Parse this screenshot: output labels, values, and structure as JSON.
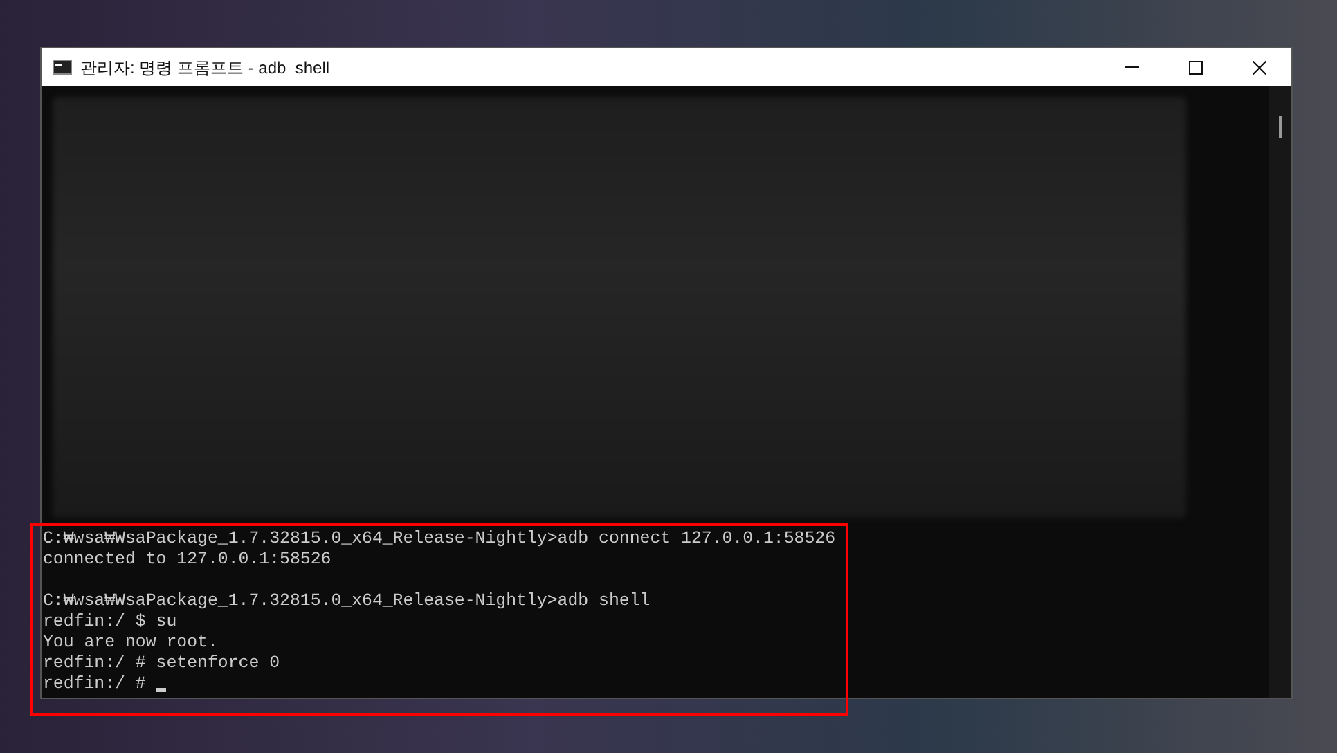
{
  "window": {
    "title": "관리자: 명령 프롬프트 - adb  shell"
  },
  "terminal": {
    "blocks": [
      [
        "C:₩wsa₩WsaPackage_1.7.32815.0_x64_Release-Nightly>adb connect 127.0.0.1:58526",
        "connected to 127.0.0.1:58526"
      ],
      [
        "C:₩wsa₩WsaPackage_1.7.32815.0_x64_Release-Nightly>adb shell",
        "redfin:/ $ su",
        "You are now root.",
        "redfin:/ # setenforce 0",
        "redfin:/ # "
      ]
    ]
  }
}
